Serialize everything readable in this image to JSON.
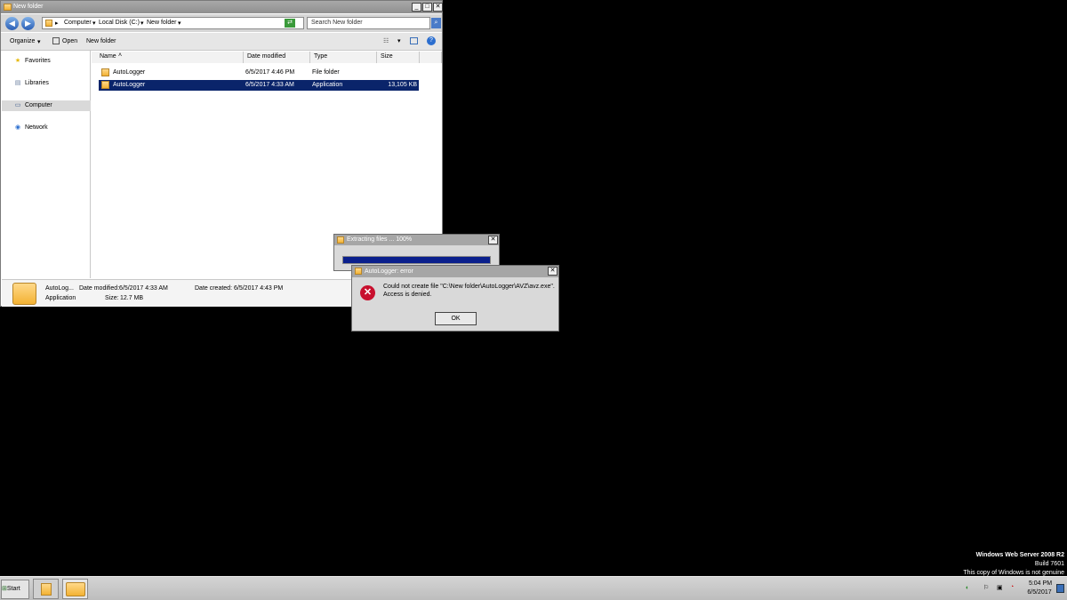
{
  "explorer": {
    "title": "New folder",
    "window_buttons": {
      "minimize": "_",
      "maximize": "□",
      "close": "✕"
    },
    "breadcrumb": [
      "Computer",
      "Local Disk (C:)",
      "New folder"
    ],
    "search_placeholder": "Search New folder",
    "toolbar": {
      "organize": "Organize",
      "open": "Open",
      "new_folder": "New folder"
    },
    "nav": {
      "favorites": "Favorites",
      "libraries": "Libraries",
      "computer": "Computer",
      "network": "Network"
    },
    "columns": {
      "name": "Name",
      "date_modified": "Date modified",
      "type": "Type",
      "size": "Size"
    },
    "files": [
      {
        "name": "AutoLogger",
        "date": "6/5/2017 4:46 PM",
        "type": "File folder",
        "size": ""
      },
      {
        "name": "AutoLogger",
        "date": "6/5/2017 4:33 AM",
        "type": "Application",
        "size": "13,105 KB"
      }
    ],
    "details": {
      "name": "AutoLog...",
      "modified_label": "Date modified:",
      "modified_value": "6/5/2017 4:33 AM",
      "created_label": "Date created:",
      "created_value": "6/5/2017 4:43 PM",
      "type": "Application",
      "size_label": "Size:",
      "size_value": "12.7 MB"
    }
  },
  "progress_dialog": {
    "title": "Extracting files ... 100%",
    "progress_fraction": 1.0
  },
  "error_dialog": {
    "title": "AutoLogger: error",
    "message_line1": "Could not create file \"C:\\New folder\\AutoLogger\\AVZ\\avz.exe\".",
    "message_line2": "Access is denied.",
    "ok": "OK"
  },
  "watermark": {
    "line1": "Windows Web Server 2008 R2",
    "line2": "Build 7601",
    "line3": "This copy of Windows is not genuine"
  },
  "taskbar": {
    "start": "Start",
    "time": "5:04 PM",
    "date": "6/5/2017"
  },
  "colors": {
    "selection": "#0a246a",
    "titlebar_inactive": "#a6a6a6",
    "progress_fill": "#0a1f8c"
  }
}
